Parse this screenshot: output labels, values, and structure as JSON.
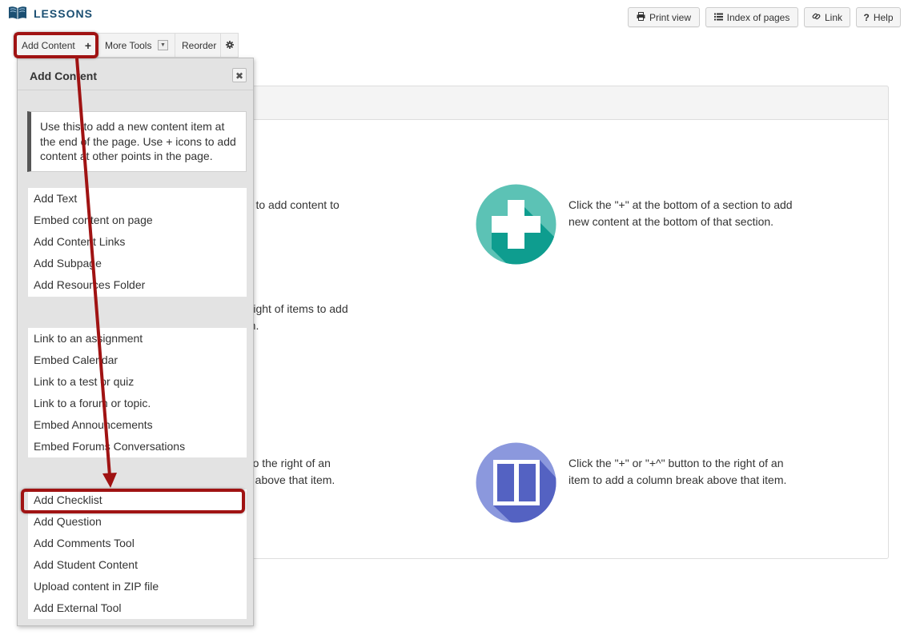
{
  "header": {
    "title": "LESSONS",
    "buttons": {
      "print": "Print view",
      "index": "Index of pages",
      "link": "Link",
      "help": "Help"
    }
  },
  "toolbar": {
    "add_content": "Add Content",
    "more_tools": "More Tools",
    "reorder": "Reorder"
  },
  "background": {
    "text1_line1": "ab to add content to",
    "text2_line1": "e right of items to add",
    "text2_line2": "em.",
    "text3_line1": "n to the right of an",
    "text3_line2": "ak above that item.",
    "plus_desc_line1": "Click the \"+\" at the bottom of a section to add",
    "plus_desc_line2": "new content at the bottom of that section.",
    "column_desc_line1": "Click the \"+\" or \"+^\" button to the right of an",
    "column_desc_line2": "item to add a column break above that item."
  },
  "dropdown": {
    "title": "Add Content",
    "note": "Use this to add a new content item at the end of the page. Use + icons to add content at other points in the page.",
    "group1": [
      "Add Text",
      "Embed content on page",
      "Add Content Links",
      "Add Subpage",
      "Add Resources Folder"
    ],
    "group2": [
      "Link to an assignment",
      "Embed Calendar",
      "Link to a test or quiz",
      "Link to a forum or topic.",
      "Embed Announcements",
      "Embed Forums Conversations"
    ],
    "group3": [
      "Add Checklist",
      "Add Question",
      "Add Comments Tool",
      "Add Student Content",
      "Upload content in ZIP file",
      "Add External Tool"
    ]
  },
  "colors": {
    "accent_teal": "#1aa58f",
    "accent_blue": "#6f7fc9",
    "highlight_red": "#a01313",
    "title_blue": "#1b4f72"
  }
}
